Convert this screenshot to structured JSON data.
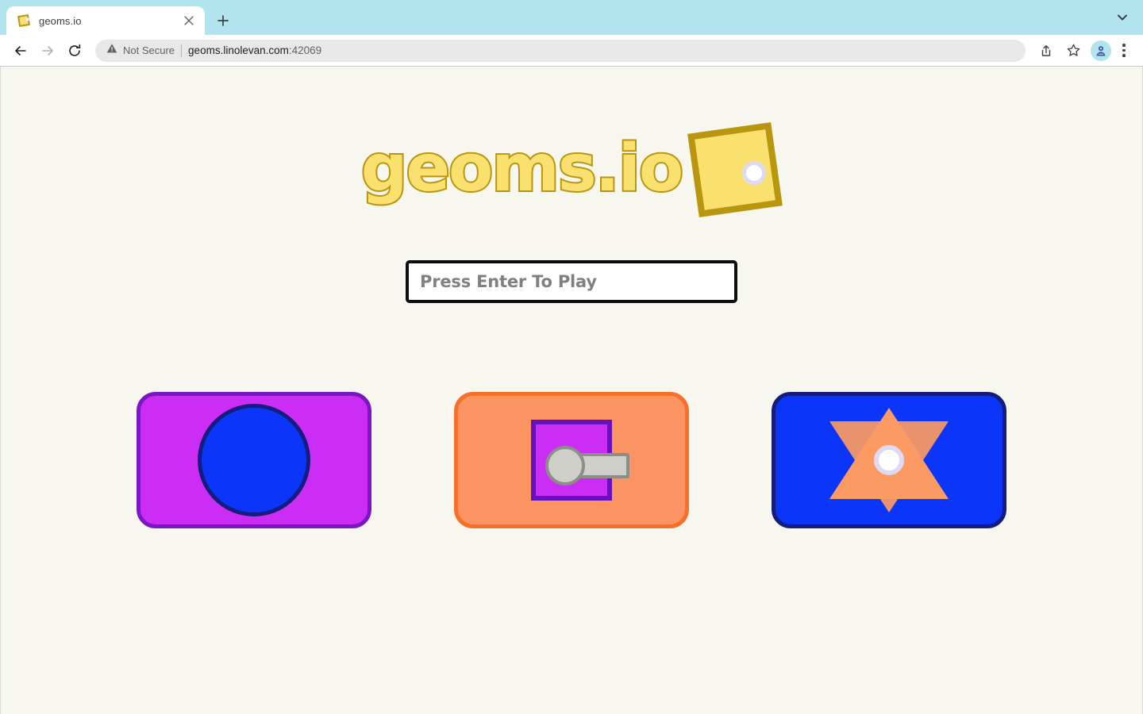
{
  "browser": {
    "tab": {
      "title": "geoms.io",
      "favicon_name": "geoms-square-favicon",
      "close_label": "×"
    },
    "new_tab_label": "+",
    "tab_search_name": "chevron-down-icon",
    "nav": {
      "back_label": "←",
      "forward_label": "→",
      "reload_label": "⟳"
    },
    "omnibox": {
      "security_label": "Not Secure",
      "url_host": "geoms.linolevan.com",
      "url_port": ":42069"
    },
    "actions": {
      "share_label": "share-icon",
      "bookmark_label": "bookmark-star-icon",
      "profile_label": "profile-avatar",
      "menu_label": "three-dot-menu"
    }
  },
  "page": {
    "logo_text": "geoms.io",
    "name_input": {
      "value": "",
      "placeholder": "Press Enter To Play"
    },
    "cards": [
      {
        "name": "card-circle",
        "background": "#CC2DF5",
        "border": "#7A17C2",
        "shape": "circle",
        "shape_fill": "#0B36FA",
        "shape_stroke": "#141C80"
      },
      {
        "name": "card-square-key",
        "background": "#FC9362",
        "border": "#F7702A",
        "shape": "square-with-key",
        "shape_fill": "#CC2DF5",
        "shape_stroke": "#6610C0",
        "key_fill": "#CFCFC9",
        "key_stroke": "#8E8E88"
      },
      {
        "name": "card-star",
        "background": "#0B36FA",
        "border": "#141C80",
        "shape": "six-point-star",
        "shape_fill": "#FB9A63",
        "dot_fill": "#FFFFFF",
        "dot_stroke": "#DEDAF5"
      }
    ],
    "colors": {
      "page_background": "#F7F7EF",
      "logo_fill": "#FAE06E",
      "logo_stroke": "#B8960F",
      "input_border": "#0D0D0D",
      "placeholder_text": "#808080"
    }
  }
}
